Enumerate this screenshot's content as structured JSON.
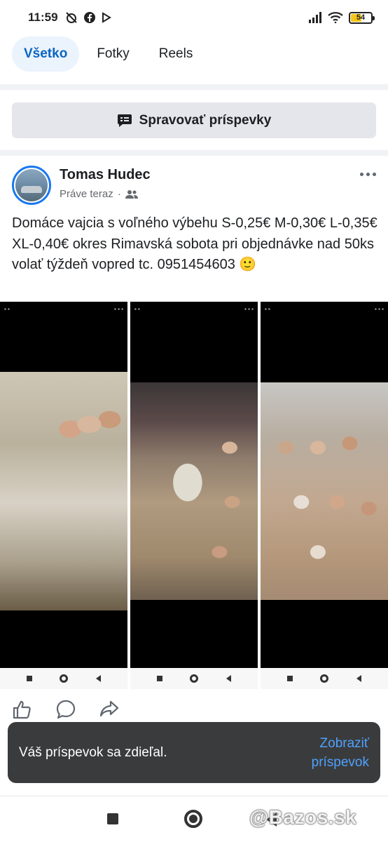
{
  "status_bar": {
    "time": "11:59",
    "battery": "54"
  },
  "tabs": [
    {
      "label": "Všetko",
      "active": true
    },
    {
      "label": "Fotky",
      "active": false
    },
    {
      "label": "Reels",
      "active": false
    }
  ],
  "manage_button": {
    "label": "Spravovať príspevky",
    "icon": "manage-posts-icon"
  },
  "post": {
    "author": "Tomas Hudec",
    "time": "Práve teraz",
    "separator": "·",
    "audience_icon": "friends-icon",
    "text": "Domáce vajcia s voľného výbehu S-0,25€ M-0,30€ L-0,35€ XL-0,40€ okres Rimavská sobota pri objednávke nad 50ks volať týždeň vopred tc. 0951454603 🙂",
    "photos": [
      {
        "icon": "egg-trays-photo"
      },
      {
        "icon": "eggs-in-hand-photo"
      },
      {
        "icon": "eggs-carton-photo"
      }
    ]
  },
  "actions": [
    "like-icon",
    "comment-icon",
    "share-icon"
  ],
  "snackbar": {
    "message": "Váš príspevok sa zdieľal.",
    "action": "Zobraziť príspevok"
  },
  "watermark": "@Bazos.sk",
  "colors": {
    "accent": "#1877f2",
    "active_tab_bg": "#ebf3fd",
    "snackbar_bg": "#3a3b3c",
    "snackbar_action": "#4ea1ff"
  }
}
